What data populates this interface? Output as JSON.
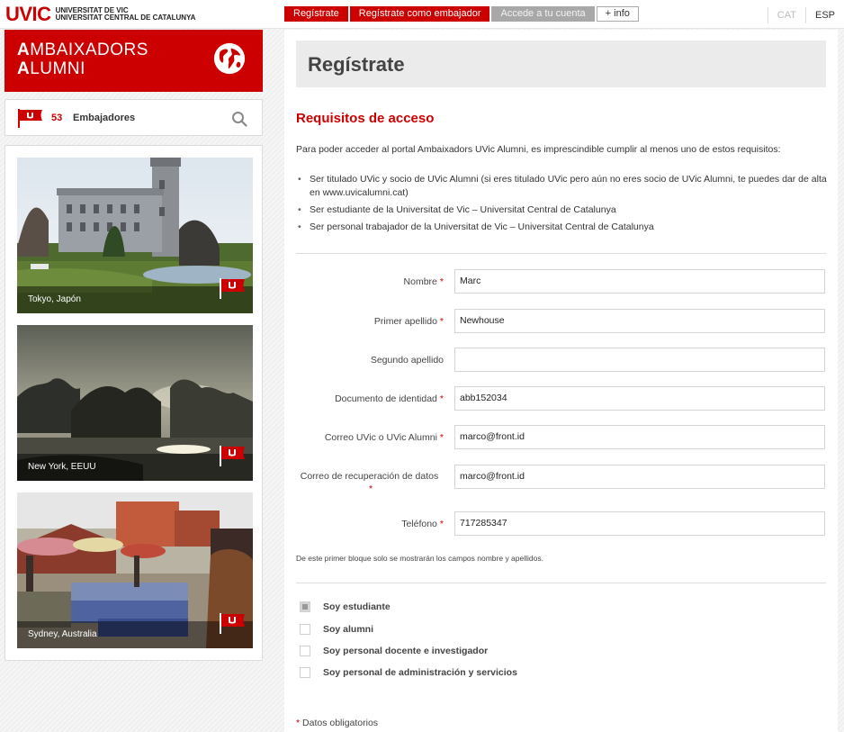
{
  "brand": {
    "logo": "UVIC",
    "line1": "UNIVERSITAT DE VIC",
    "line2": "UNIVERSITAT CENTRAL DE CATALUNYA"
  },
  "topnav": {
    "register": "Regístrate",
    "register_ambassador": "Regístrate como embajador",
    "login": "Accede a tu cuenta",
    "info": "+ info"
  },
  "lang": {
    "cat": "CAT",
    "esp": "ESP"
  },
  "sidebar": {
    "title_line1_initial": "A",
    "title_line1_rest": "MBAIXADORS",
    "title_line2_initial": "A",
    "title_line2_rest": "LUMNI",
    "count": "53",
    "count_label": "Embajadores",
    "cards": [
      {
        "caption": "Tokyo, Japón"
      },
      {
        "caption": "New York, EEUU"
      },
      {
        "caption": "Sydney, Australia"
      }
    ]
  },
  "main": {
    "title": "Regístrate",
    "req_title": "Requisitos de acceso",
    "intro": "Para poder acceder al portal Ambaixadors  UVic Alumni, es imprescindible cumplir al menos uno de estos requisitos:",
    "requirements": [
      "Ser titulado UVic y socio de UVic Alumni (si eres titulado UVic pero aún no eres socio de UVic Alumni, te puedes dar de alta en www.uvicalumni.cat)",
      "Ser estudiante de la Universitat de Vic – Universitat Central de Catalunya",
      "Ser personal trabajador de la Universitat de Vic – Universitat Central de Catalunya"
    ],
    "form": {
      "nombre_label": "Nombre",
      "nombre_value": "Marc",
      "apellido1_label": "Primer apellido",
      "apellido1_value": "Newhouse",
      "apellido2_label": "Segundo apellido",
      "apellido2_value": "",
      "documento_label": "Documento de identidad",
      "documento_value": "abb152034",
      "correo_label": "Correo UVic o UVic Alumni",
      "correo_value": "marco@front.id",
      "recuperacion_label": "Correo de recuperación de datos",
      "recuperacion_value": "marco@front.id",
      "telefono_label": "Teléfono",
      "telefono_value": "717285347",
      "required_mark": "*"
    },
    "note": "De este primer bloque solo se mostrarán los campos nombre y apellidos.",
    "checkboxes": [
      {
        "label": "Soy estudiante",
        "checked": true
      },
      {
        "label": "Soy alumni",
        "checked": false
      },
      {
        "label": "Soy personal docente e investigador",
        "checked": false
      },
      {
        "label": "Soy personal de administración y servicios",
        "checked": false
      }
    ],
    "mandatory": "Datos obligatorios"
  },
  "colors": {
    "brand_red": "#cc0000",
    "grey_button": "#a8a8a8"
  },
  "icons": [
    "globe-icon",
    "flag-icon",
    "search-icon"
  ]
}
